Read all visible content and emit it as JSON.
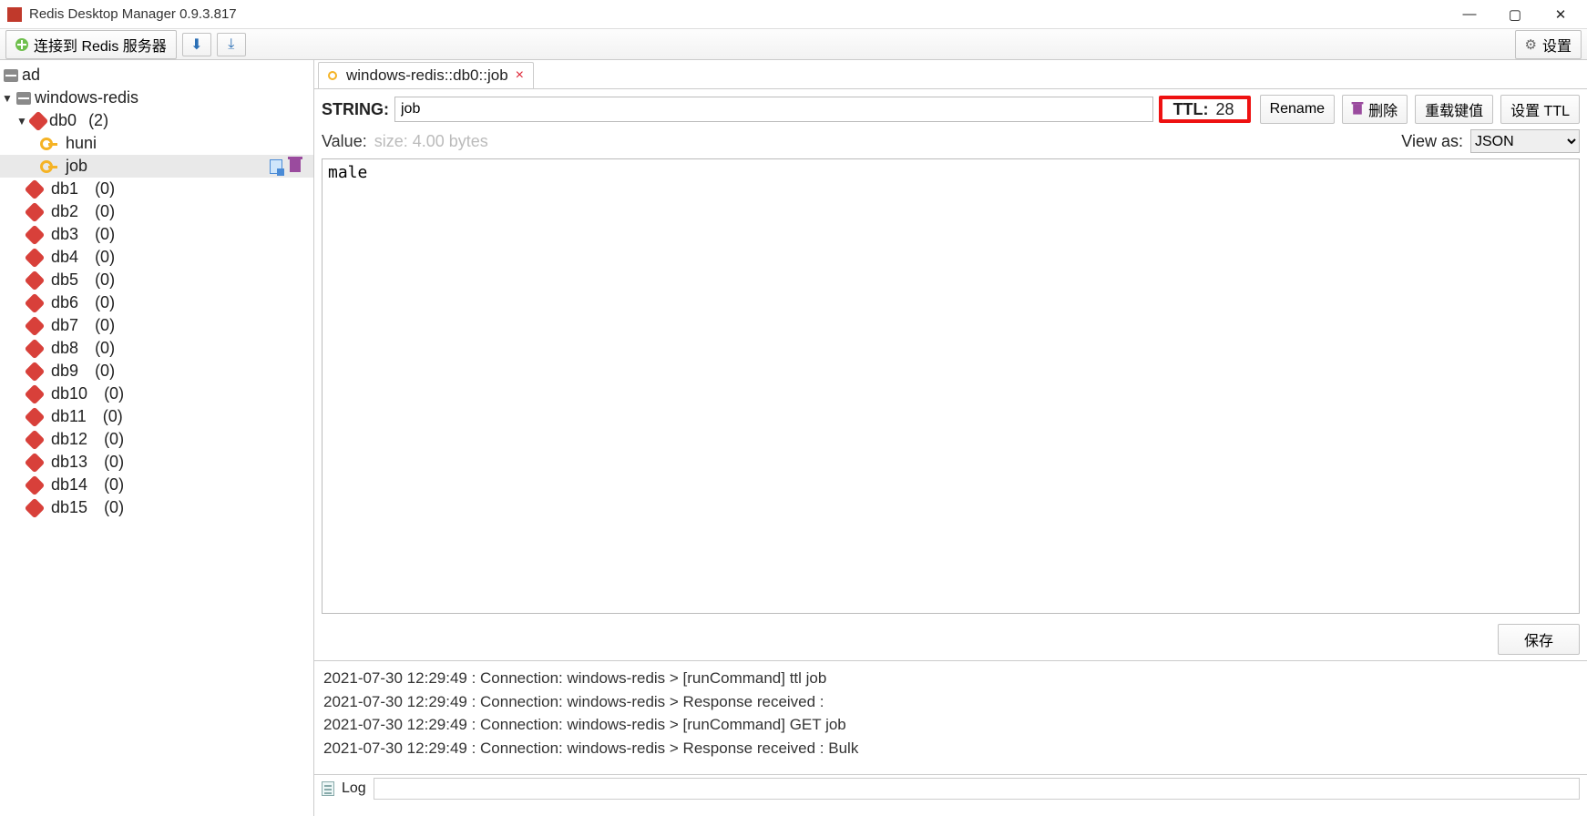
{
  "window": {
    "title": "Redis Desktop Manager 0.9.3.817"
  },
  "toolbar": {
    "connect_label": "连接到 Redis 服务器",
    "settings_label": "设置"
  },
  "sidebar": {
    "connections": [
      {
        "name": "ad",
        "expanded": false
      },
      {
        "name": "windows-redis",
        "expanded": true,
        "dbs": [
          {
            "name": "db0",
            "count": "(2)",
            "expanded": true,
            "keys": [
              {
                "name": "huni"
              },
              {
                "name": "job",
                "selected": true
              }
            ]
          },
          {
            "name": "db1",
            "count": "(0)"
          },
          {
            "name": "db2",
            "count": "(0)"
          },
          {
            "name": "db3",
            "count": "(0)"
          },
          {
            "name": "db4",
            "count": "(0)"
          },
          {
            "name": "db5",
            "count": "(0)"
          },
          {
            "name": "db6",
            "count": "(0)"
          },
          {
            "name": "db7",
            "count": "(0)"
          },
          {
            "name": "db8",
            "count": "(0)"
          },
          {
            "name": "db9",
            "count": "(0)"
          },
          {
            "name": "db10",
            "count": "(0)"
          },
          {
            "name": "db11",
            "count": "(0)"
          },
          {
            "name": "db12",
            "count": "(0)"
          },
          {
            "name": "db13",
            "count": "(0)"
          },
          {
            "name": "db14",
            "count": "(0)"
          },
          {
            "name": "db15",
            "count": "(0)"
          }
        ]
      }
    ]
  },
  "tab": {
    "title": "windows-redis::db0::job"
  },
  "key": {
    "type_label": "STRING:",
    "name": "job",
    "ttl_label": "TTL:",
    "ttl_value": "28",
    "rename_btn": "Rename",
    "delete_btn": "删除",
    "reload_btn": "重载键值",
    "set_ttl_btn": "设置 TTL"
  },
  "value": {
    "label": "Value:",
    "size": "size: 4.00 bytes",
    "viewas_label": "View as:",
    "viewas_selected": "JSON",
    "content": "male",
    "save_btn": "保存"
  },
  "log": {
    "lines": [
      "2021-07-30 12:29:49 : Connection: windows-redis > [runCommand] ttl job",
      "2021-07-30 12:29:49 : Connection: windows-redis > Response received :",
      "2021-07-30 12:29:49 : Connection: windows-redis > [runCommand] GET job",
      "2021-07-30 12:29:49 : Connection: windows-redis > Response received : Bulk"
    ],
    "footer_label": "Log"
  }
}
